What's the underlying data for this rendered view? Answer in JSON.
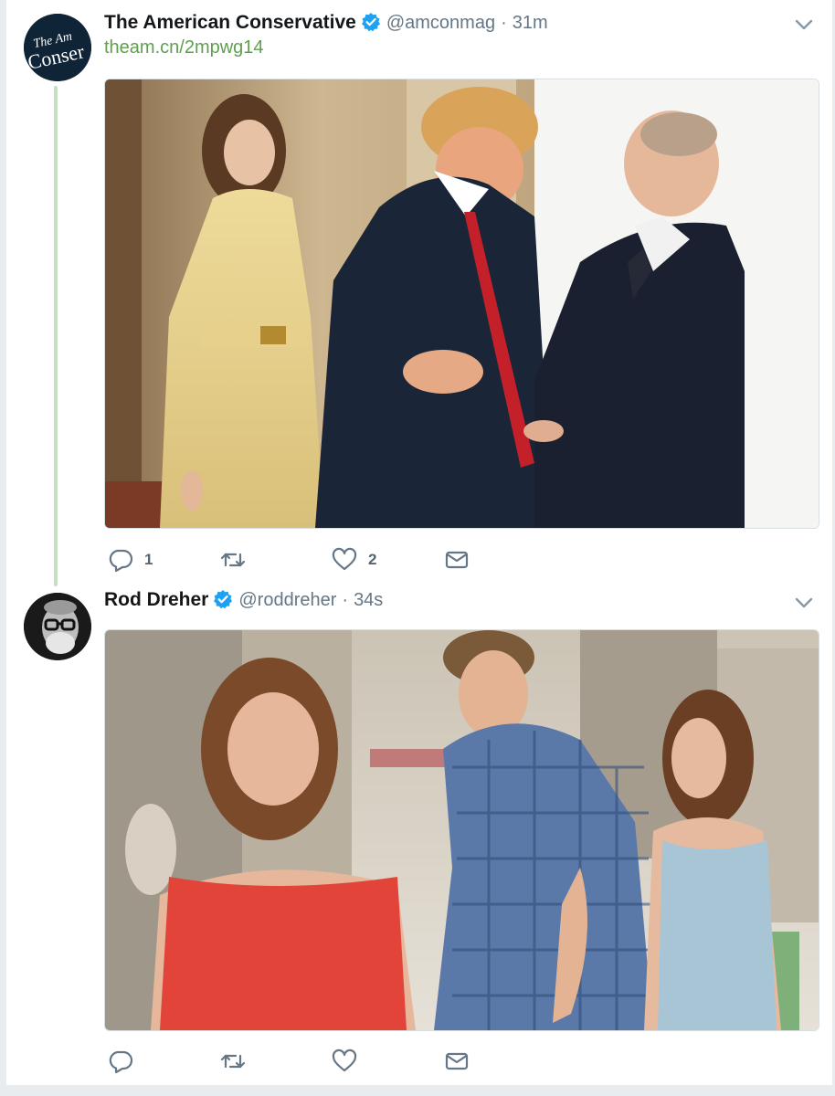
{
  "tweets": [
    {
      "author_name": "The American Conservative",
      "handle": "@amconmag",
      "separator": "·",
      "time": "31m",
      "link": "theam.cn/2mpwg14",
      "avatar_text_1": "The Am",
      "avatar_text_2": "Conser",
      "reply_count": "1",
      "retweet_count": "",
      "like_count": "2"
    },
    {
      "author_name": "Rod Dreher",
      "handle": "@roddreher",
      "separator": "·",
      "time": "34s",
      "reply_count": "",
      "retweet_count": "",
      "like_count": ""
    }
  ],
  "icons": {
    "verified": "verified-badge-icon",
    "caret": "chevron-down-icon",
    "reply": "reply-icon",
    "retweet": "retweet-icon",
    "like": "heart-icon",
    "dm": "envelope-icon"
  },
  "colors": {
    "link": "#5fa04e",
    "thread_line": "#c5dfc3",
    "verified": "#1da1f2",
    "muted": "#657786"
  }
}
